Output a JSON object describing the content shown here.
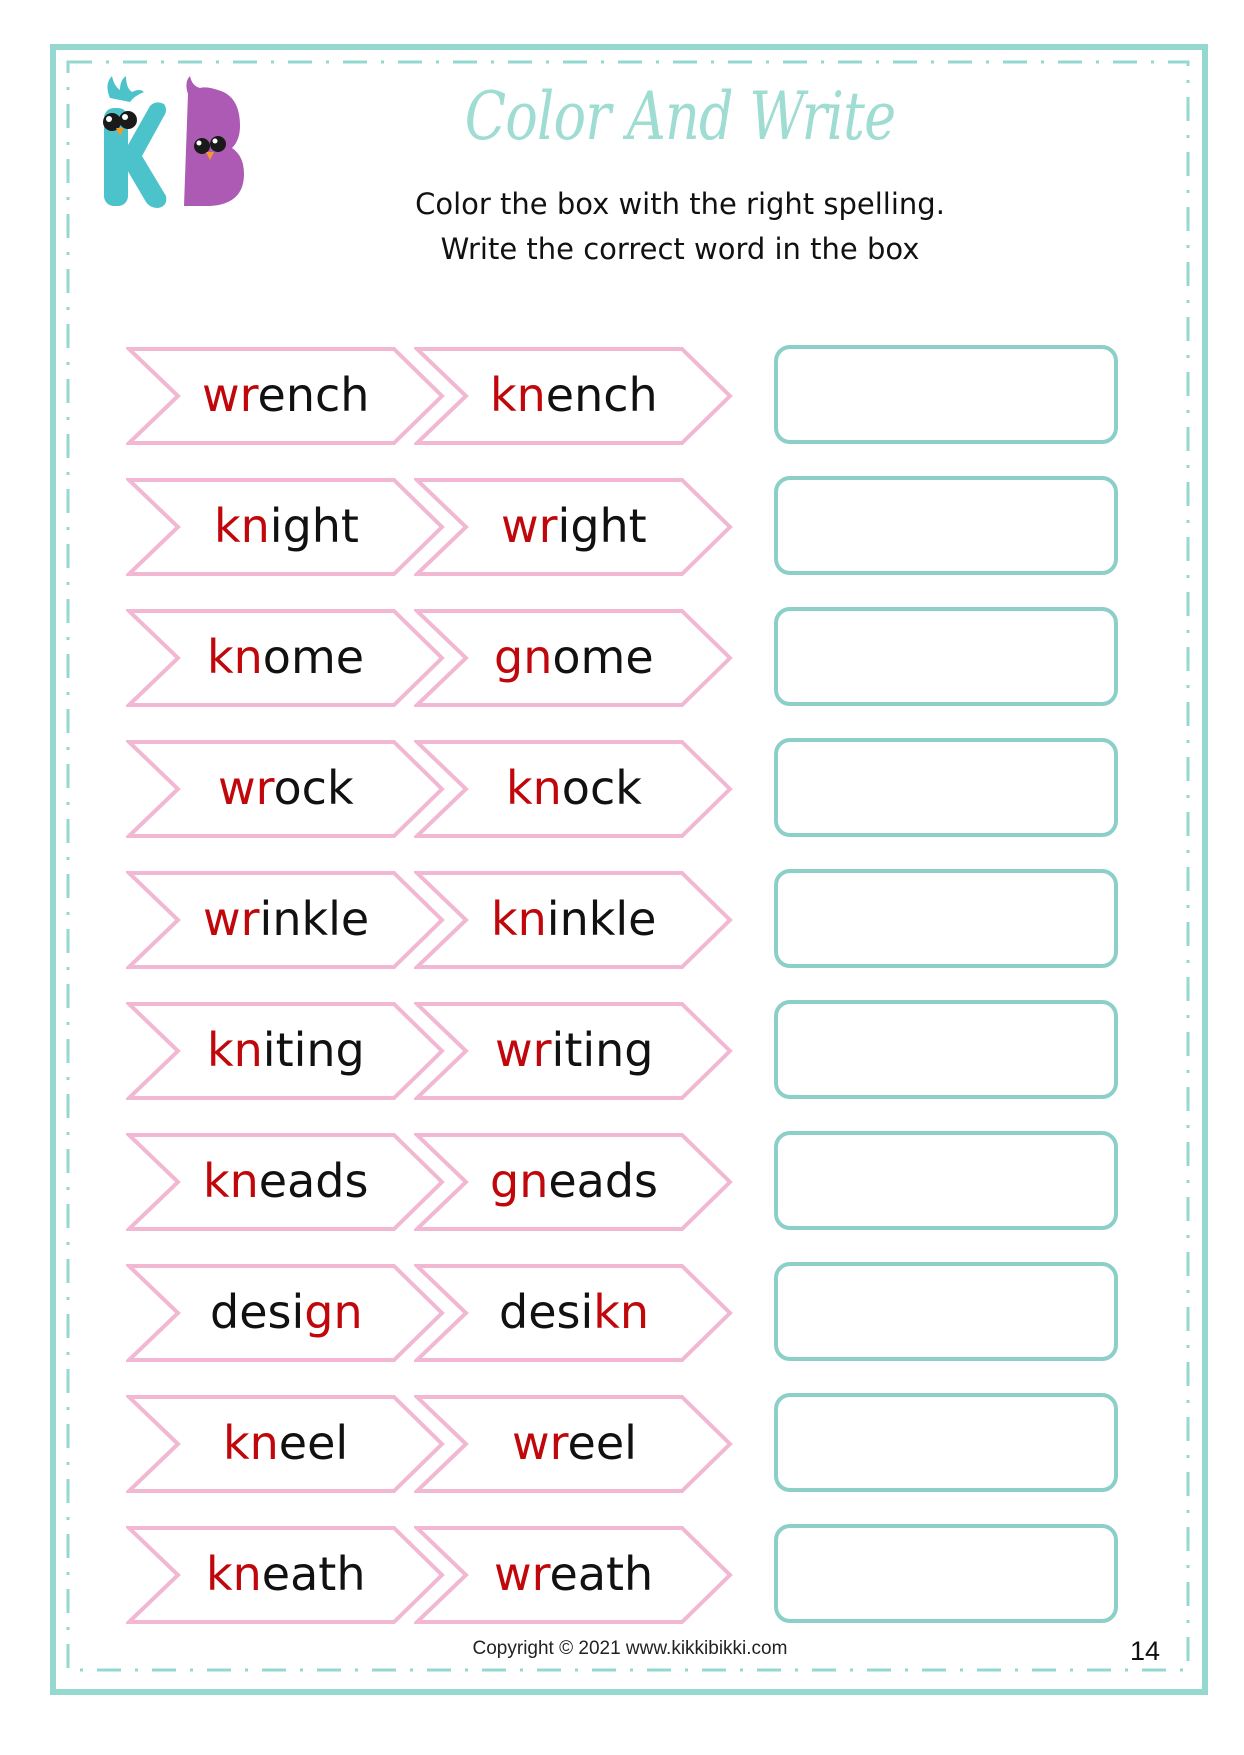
{
  "header": {
    "title": "Color And Write",
    "instructions": [
      "Color the box with the right spelling.",
      "Write the correct word in the box"
    ],
    "logo": "kikkibikki-kb-logo"
  },
  "colors": {
    "border": "#95d8d0",
    "title": "#9fdcd2",
    "chevron_outline": "#f2b8d3",
    "highlight_letters": "#c0070b",
    "write_box_border": "#8ccfc9"
  },
  "rows": [
    {
      "option_a": {
        "pre": "",
        "red": "wr",
        "post": "ench"
      },
      "option_b": {
        "pre": "",
        "red": "kn",
        "post": "ench"
      },
      "answer": ""
    },
    {
      "option_a": {
        "pre": "",
        "red": "kn",
        "post": "ight"
      },
      "option_b": {
        "pre": "",
        "red": "wr",
        "post": "ight"
      },
      "answer": ""
    },
    {
      "option_a": {
        "pre": "",
        "red": "kn",
        "post": "ome"
      },
      "option_b": {
        "pre": "",
        "red": "gn",
        "post": "ome"
      },
      "answer": ""
    },
    {
      "option_a": {
        "pre": "",
        "red": "wr",
        "post": "ock"
      },
      "option_b": {
        "pre": "",
        "red": "kn",
        "post": "ock"
      },
      "answer": ""
    },
    {
      "option_a": {
        "pre": "",
        "red": "wr",
        "post": "inkle"
      },
      "option_b": {
        "pre": "",
        "red": "kn",
        "post": "inkle"
      },
      "answer": ""
    },
    {
      "option_a": {
        "pre": "",
        "red": "kn",
        "post": "iting"
      },
      "option_b": {
        "pre": "",
        "red": "wr",
        "post": "iting"
      },
      "answer": ""
    },
    {
      "option_a": {
        "pre": "",
        "red": "kn",
        "post": "eads"
      },
      "option_b": {
        "pre": "",
        "red": "gn",
        "post": "eads"
      },
      "answer": ""
    },
    {
      "option_a": {
        "pre": "desi",
        "red": "gn",
        "post": ""
      },
      "option_b": {
        "pre": "desi",
        "red": "kn",
        "post": ""
      },
      "answer": ""
    },
    {
      "option_a": {
        "pre": "",
        "red": "kn",
        "post": "eel"
      },
      "option_b": {
        "pre": "",
        "red": "wr",
        "post": "eel"
      },
      "answer": ""
    },
    {
      "option_a": {
        "pre": "",
        "red": "kn",
        "post": "eath"
      },
      "option_b": {
        "pre": "",
        "red": "wr",
        "post": "eath"
      },
      "answer": ""
    }
  ],
  "footer": {
    "copyright": "Copyright © 2021 www.kikkibikki.com",
    "page_number": "14"
  }
}
